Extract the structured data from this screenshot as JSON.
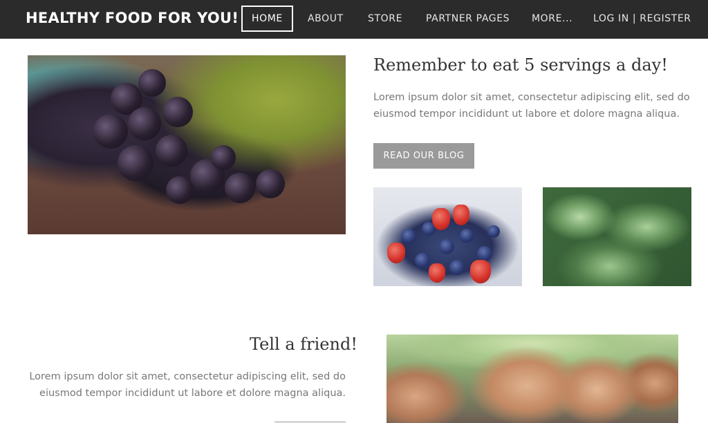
{
  "header": {
    "site_title": "HEALTHY FOOD FOR YOU!",
    "nav": [
      "HOME",
      "ABOUT",
      "STORE",
      "PARTNER PAGES",
      "MORE...",
      "LOG IN | REGISTER"
    ]
  },
  "section1": {
    "heading": "Remember to eat 5 servings a day!",
    "text": "Lorem ipsum dolor sit amet, consectetur adipiscing elit, sed do eiusmod tempor incididunt ut labore et dolore magna aliqua.",
    "button_label": "READ OUR BLOG"
  },
  "section2": {
    "heading": "Tell a friend!",
    "text": "Lorem ipsum dolor sit amet, consectetur adipiscing elit, sed do eiusmod tempor incididunt ut labore et dolore magna aliqua."
  },
  "colors": {
    "header_bg": "#2b2b2b",
    "button_bg": "#9a9a9a"
  }
}
